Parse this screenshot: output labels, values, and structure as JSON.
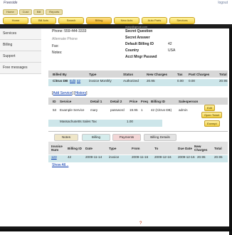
{
  "header": {
    "logo": "Freeside",
    "top_link": "logout",
    "nav_small": [
      "Home",
      "Cust",
      "Bill",
      "Reports"
    ],
    "nav_main": [
      "Home",
      "Bill Acts",
      "Search",
      "Billing",
      "New Acts",
      "Auto Parts",
      "Services"
    ]
  },
  "sidebar": {
    "items": [
      "Services",
      "Billing",
      "Support",
      "Free messages"
    ]
  },
  "info": {
    "phone": "Phone: 559-444-3333",
    "alt_phone": "Alternate Phone",
    "fax": "Fax:",
    "notes": "Notes:",
    "email": "mary@gmail.com",
    "secret_q": "Secret Question",
    "secret_a": "Secret Answer",
    "billing_id_label": "Default Billing ID",
    "billing_id_value": "42",
    "country_label": "Country",
    "country_value": "USA",
    "acct_label": "Acct Mngr Passwd"
  },
  "billing_table": {
    "headers": [
      "Billed By",
      "Type",
      "Status",
      "New Charges",
      "Tax",
      "Past Charges",
      "Total"
    ],
    "row": {
      "billed_by": "Citrus DB",
      "edit": "Edit",
      "edit_num": "42",
      "type": "invoice Monthly",
      "status": "Authorized",
      "new_charges": "20.95",
      "tax": "0.00",
      "past_charges": "0.00",
      "total": "20.95"
    }
  },
  "links": {
    "add": "Add Service",
    "history": "History"
  },
  "service_table": {
    "headers": [
      "ID",
      "Service",
      "Detail 1",
      "Detail 2",
      "Price",
      "Freq",
      "Billing ID",
      "Salesperson"
    ],
    "row": {
      "id": "53",
      "service": "Example Service",
      "detail1": "mary",
      "detail2": "password",
      "price": "19.95",
      "freq": "1",
      "billing_id": "42 (Citrus DB)",
      "salesperson": "admin"
    },
    "tax_label": "Massachusetts Sales Tax",
    "tax_value": "1.00",
    "btn_edit": "Edit",
    "btn_open": "Open Ticket",
    "btn_exempt": "Exempt"
  },
  "tabs": [
    "Notes",
    "Billing",
    "Payments",
    "Billing Details"
  ],
  "invoice_table": {
    "headers": [
      "Invoice Num",
      "Billing ID",
      "Date",
      "Type",
      "From",
      "To",
      "Due Date",
      "New Charges",
      "Total"
    ],
    "row": {
      "num": "123",
      "billing_id": "42",
      "date": "2009-11-14",
      "type": "invoice",
      "from": "2009-11-16",
      "to": "2009-12-16",
      "due": "2009-12-16",
      "new_charges": "20.95",
      "total": "20.95"
    },
    "show_all": "Show All..."
  },
  "footer_mark": "?"
}
